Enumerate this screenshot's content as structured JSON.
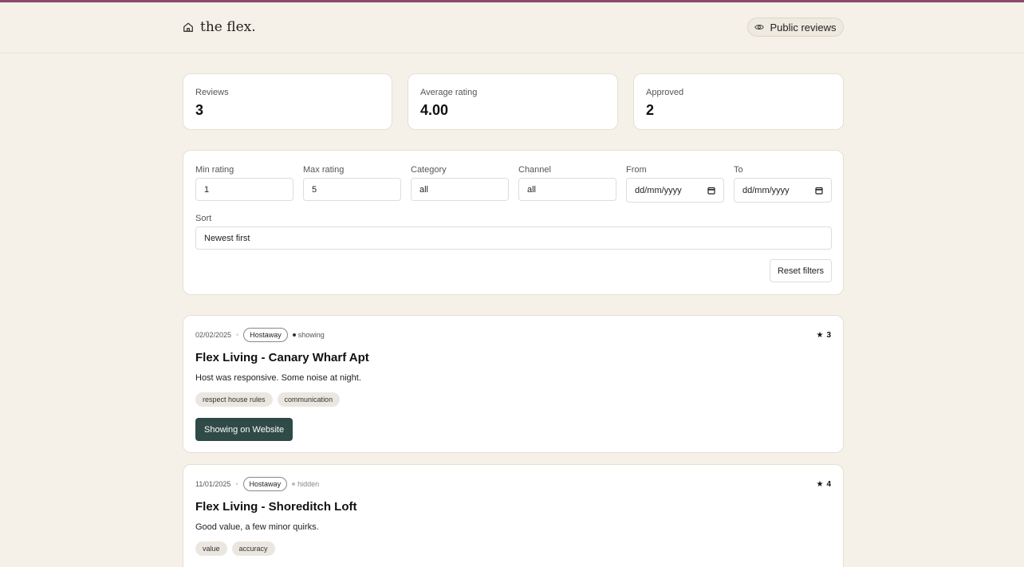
{
  "header": {
    "brand": "the flex.",
    "public_reviews_label": "Public reviews"
  },
  "stats": [
    {
      "label": "Reviews",
      "value": "3"
    },
    {
      "label": "Average rating",
      "value": "4.00"
    },
    {
      "label": "Approved",
      "value": "2"
    }
  ],
  "filters": {
    "min_rating": {
      "label": "Min rating",
      "value": "1"
    },
    "max_rating": {
      "label": "Max rating",
      "value": "5"
    },
    "category": {
      "label": "Category",
      "value": "all"
    },
    "channel": {
      "label": "Channel",
      "value": "all"
    },
    "from": {
      "label": "From",
      "placeholder": "dd/mm/yyyy"
    },
    "to": {
      "label": "To",
      "placeholder": "dd/mm/yyyy"
    },
    "sort": {
      "label": "Sort",
      "value": "Newest first"
    },
    "reset_label": "Reset filters"
  },
  "reviews": [
    {
      "date": "02/02/2025",
      "channel": "Hostaway",
      "status": "showing",
      "rating": "3",
      "title": "Flex Living - Canary Wharf Apt",
      "text": "Host was responsive. Some noise at night.",
      "tags": [
        "respect house rules",
        "communication"
      ],
      "action_label": "Showing on Website"
    },
    {
      "date": "11/01/2025",
      "channel": "Hostaway",
      "status": "hidden",
      "rating": "4",
      "title": "Flex Living - Shoreditch Loft",
      "text": "Good value, a few minor quirks.",
      "tags": [
        "value",
        "accuracy"
      ]
    }
  ],
  "colors": {
    "background": "#f5f1e8",
    "accent_button": "#2f4a47",
    "top_rule": "#8a4a6b"
  }
}
